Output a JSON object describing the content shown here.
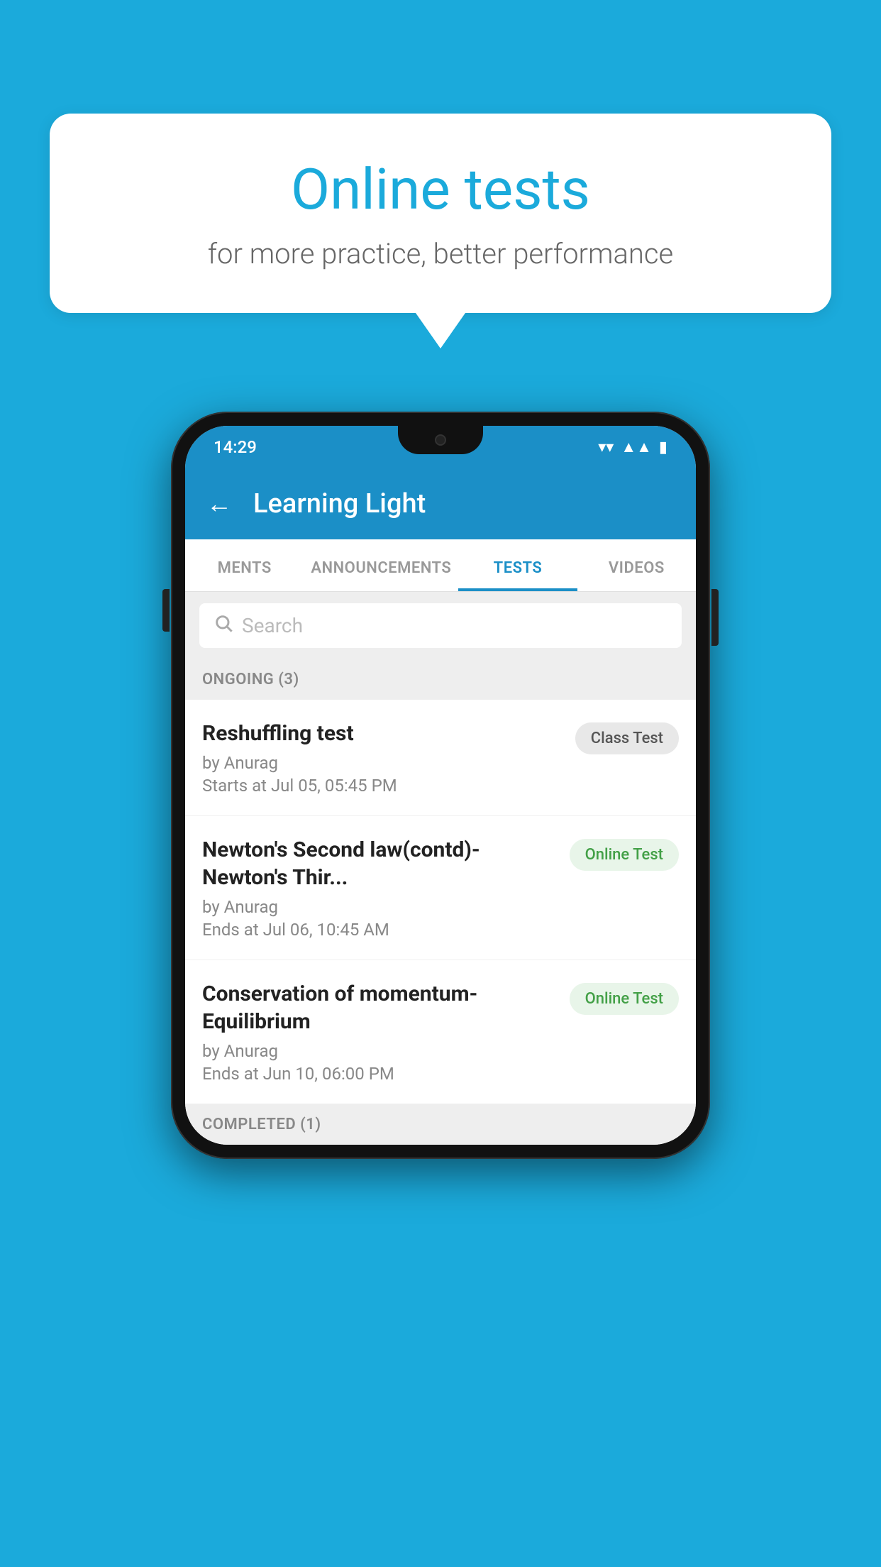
{
  "background": {
    "color": "#1BAADB"
  },
  "speech_bubble": {
    "title": "Online tests",
    "subtitle": "for more practice, better performance"
  },
  "phone": {
    "status_bar": {
      "time": "14:29",
      "wifi": "▼",
      "signal": "◂",
      "battery": "▮"
    },
    "header": {
      "back_label": "←",
      "title": "Learning Light"
    },
    "tabs": [
      {
        "label": "MENTS",
        "active": false
      },
      {
        "label": "ANNOUNCEMENTS",
        "active": false
      },
      {
        "label": "TESTS",
        "active": true
      },
      {
        "label": "VIDEOS",
        "active": false
      }
    ],
    "search": {
      "placeholder": "Search"
    },
    "ongoing_section": {
      "label": "ONGOING (3)",
      "items": [
        {
          "name": "Reshuffling test",
          "by": "by Anurag",
          "time_label": "Starts at",
          "time": "Jul 05, 05:45 PM",
          "badge": "Class Test",
          "badge_type": "class"
        },
        {
          "name": "Newton's Second law(contd)-Newton's Thir...",
          "by": "by Anurag",
          "time_label": "Ends at",
          "time": "Jul 06, 10:45 AM",
          "badge": "Online Test",
          "badge_type": "online"
        },
        {
          "name": "Conservation of momentum-Equilibrium",
          "by": "by Anurag",
          "time_label": "Ends at",
          "time": "Jun 10, 06:00 PM",
          "badge": "Online Test",
          "badge_type": "online"
        }
      ]
    },
    "completed_section": {
      "label": "COMPLETED (1)"
    }
  }
}
